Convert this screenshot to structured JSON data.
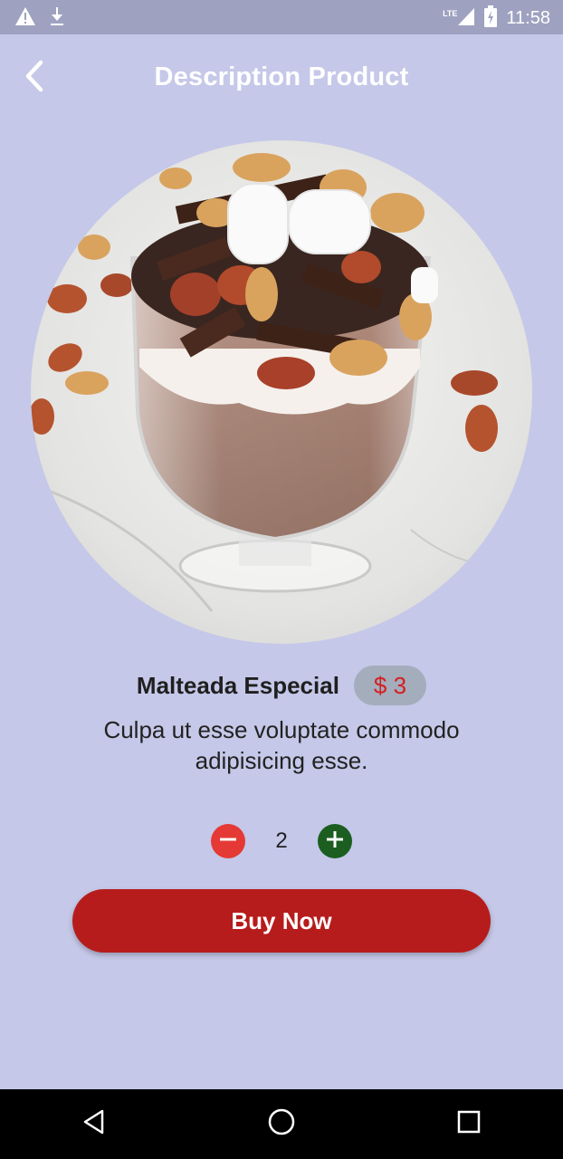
{
  "status_bar": {
    "time": "11:58",
    "network_label": "LTE",
    "icons": [
      "warning-icon",
      "download-icon",
      "signal-icon",
      "battery-icon"
    ]
  },
  "app_bar": {
    "title": "Description Product",
    "back_icon": "chevron-left-icon"
  },
  "product": {
    "name": "Malteada Especial",
    "price": "$ 3",
    "description": "Culpa ut esse voluptate commodo adipisicing esse."
  },
  "quantity": {
    "value": "2",
    "decrement_icon": "minus-circle-icon",
    "increment_icon": "plus-circle-icon"
  },
  "actions": {
    "buy_label": "Buy Now"
  },
  "colors": {
    "background": "#c5c8e8",
    "status_bar": "#9ea2c0",
    "price_badge": "#a4adbc",
    "price_text": "#d32020",
    "buy_button": "#b71c1c",
    "minus_button": "#e53935",
    "plus_button": "#1b5e20"
  },
  "nav_bar": {
    "icons": [
      "back-triangle-icon",
      "home-circle-icon",
      "recents-square-icon"
    ]
  }
}
